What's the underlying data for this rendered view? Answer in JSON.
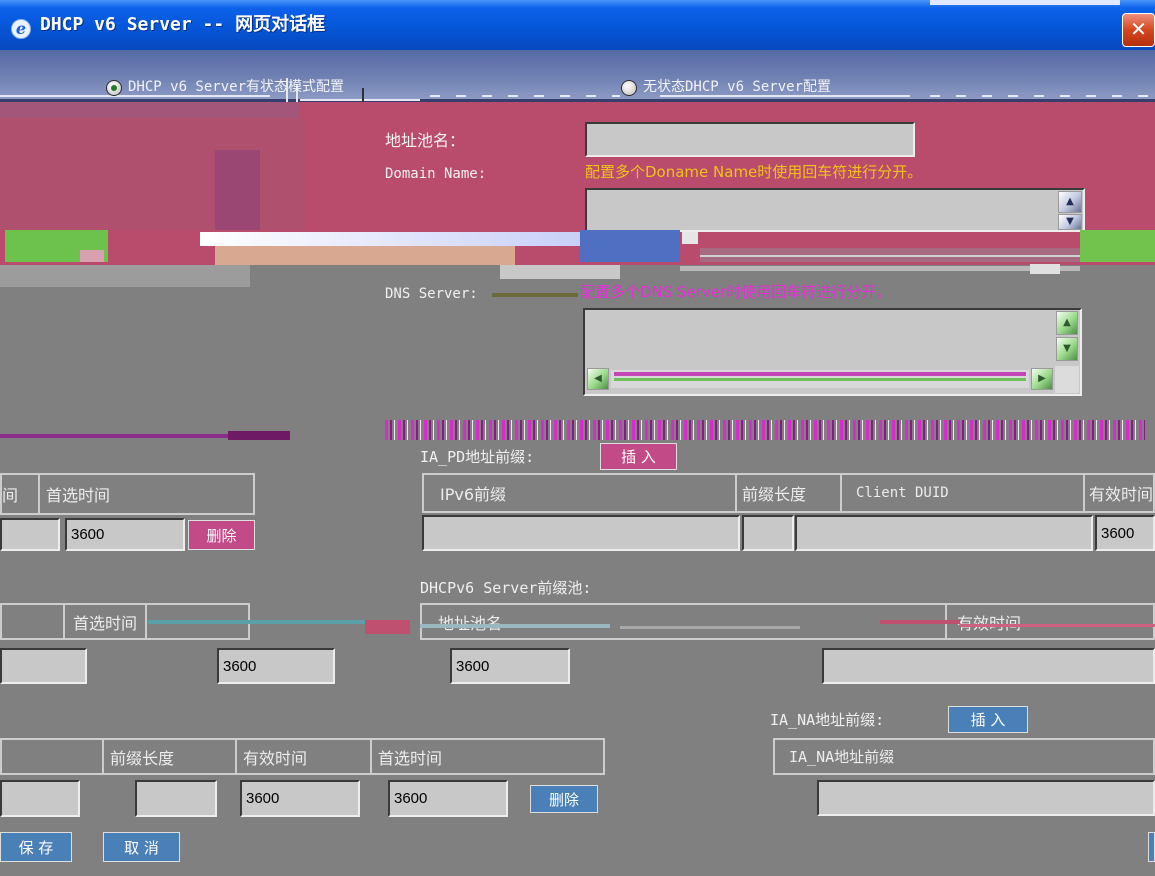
{
  "window": {
    "title": "DHCP v6 Server -- 网页对话框",
    "app_icon": "ie-icon",
    "close_icon": "close-icon"
  },
  "mode": {
    "options": [
      {
        "label": "DHCP v6 Server有状态模式配置",
        "selected": true,
        "icon": "radio-icon"
      },
      {
        "label": "无状态DHCP v6 Server配置",
        "selected": false,
        "icon": "radio-icon"
      }
    ]
  },
  "pool": {
    "name_label": "地址池名：",
    "name_value": "",
    "domain_label": "Domain Name:",
    "domain_hint": "配置多个Doname Name时使用回车符进行分开。",
    "domain_value": "",
    "dns_label": "DNS Server:",
    "dns_hint": "配置多个DNS Server时使用回车符进行分开。",
    "dns_value": ""
  },
  "address_table": {
    "headers": [
      "间",
      "首选时间"
    ],
    "row": [
      "",
      "3600"
    ],
    "delete_label": "删除"
  },
  "ia_pd": {
    "label": "IA_PD地址前缀:",
    "insert_label": "插 入",
    "headers": [
      "IPv6前缀",
      "前缀长度",
      "Client DUID",
      "有效时间"
    ],
    "row": [
      "",
      "",
      "",
      "3600"
    ]
  },
  "prefix_pool": {
    "label": "DHCPv6 Server前缀池:",
    "headers": [
      "首选时间",
      "地址池名",
      "有效时间"
    ],
    "row": [
      "",
      "3600",
      "3600",
      ""
    ]
  },
  "ia_na": {
    "label": "IA_NA地址前缀:",
    "insert_label": "插 入",
    "header": "IA_NA地址前缀",
    "value": ""
  },
  "prefix_table": {
    "headers": [
      "",
      "前缀长度",
      "有效时间",
      "首选时间"
    ],
    "row": [
      "",
      "",
      "3600",
      "3600"
    ],
    "delete_label": "删除"
  },
  "footer": {
    "save_label": "保 存",
    "cancel_label": "取 消"
  },
  "colors": {
    "title_bar": "#0556d8",
    "mode_band": "#6f80b2",
    "pink_panel": "#b94b6c",
    "background": "#808080",
    "domain_hint": "#f2c21a",
    "dns_hint": "#e431d6",
    "button_magenta": "#c24a86",
    "button_blue": "#4a80b8",
    "field": "#c8c8c8"
  }
}
